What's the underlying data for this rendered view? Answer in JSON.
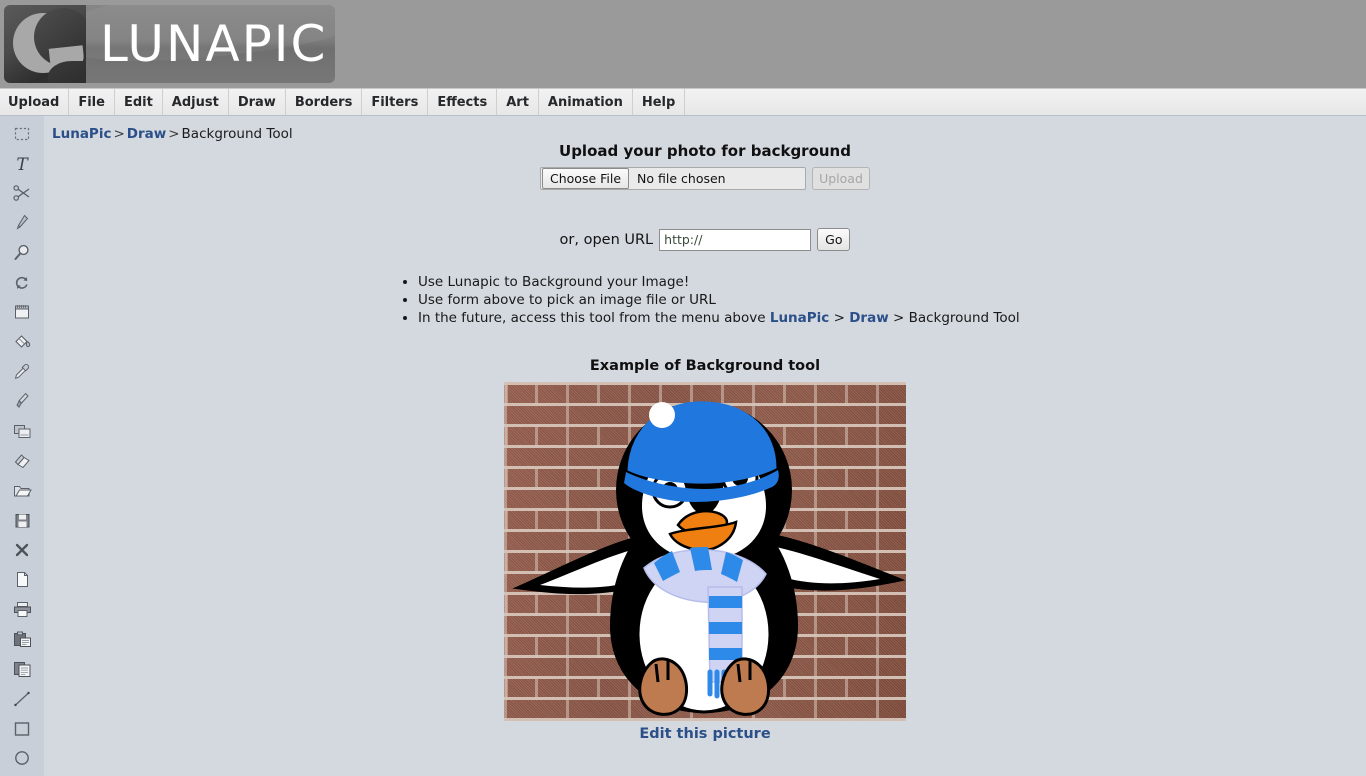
{
  "header": {
    "logo_text": "LUNAPIC",
    "logo_icon": "crescent-moon-icon"
  },
  "menubar": {
    "items": [
      {
        "label": "Upload"
      },
      {
        "label": "File"
      },
      {
        "label": "Edit"
      },
      {
        "label": "Adjust"
      },
      {
        "label": "Draw"
      },
      {
        "label": "Borders"
      },
      {
        "label": "Filters"
      },
      {
        "label": "Effects"
      },
      {
        "label": "Art"
      },
      {
        "label": "Animation"
      },
      {
        "label": "Help"
      }
    ]
  },
  "breadcrumb": {
    "root": "LunaPic",
    "sep1": ">",
    "section": "Draw",
    "sep2": ">",
    "current": "Background Tool"
  },
  "toolbar": {
    "tools": [
      {
        "name": "marquee-select-icon",
        "title": "Select"
      },
      {
        "name": "text-icon",
        "title": "Text"
      },
      {
        "name": "scissors-icon",
        "title": "Crop / Cut"
      },
      {
        "name": "pencil-icon",
        "title": "Pencil"
      },
      {
        "name": "magnifier-icon",
        "title": "Zoom"
      },
      {
        "name": "rotate-icon",
        "title": "Rotate"
      },
      {
        "name": "notepad-icon",
        "title": "Notes"
      },
      {
        "name": "paint-bucket-icon",
        "title": "Fill"
      },
      {
        "name": "eyedropper-icon",
        "title": "Color Picker"
      },
      {
        "name": "paintbrush-icon",
        "title": "Brush"
      },
      {
        "name": "layers-icon",
        "title": "Layers"
      },
      {
        "name": "eraser-icon",
        "title": "Eraser"
      },
      {
        "name": "open-folder-icon",
        "title": "Open"
      },
      {
        "name": "save-floppy-icon",
        "title": "Save"
      },
      {
        "name": "close-x-icon",
        "title": "Close"
      },
      {
        "name": "new-page-icon",
        "title": "New"
      },
      {
        "name": "printer-icon",
        "title": "Print"
      },
      {
        "name": "paste-icon",
        "title": "Paste"
      },
      {
        "name": "copy-icon",
        "title": "Copy"
      },
      {
        "name": "line-icon",
        "title": "Line"
      },
      {
        "name": "rectangle-icon",
        "title": "Rectangle"
      },
      {
        "name": "ellipse-icon",
        "title": "Ellipse"
      }
    ]
  },
  "upload": {
    "title": "Upload your photo for background",
    "choose_file_label": "Choose File",
    "file_name_text": "No file chosen",
    "upload_button_label": "Upload",
    "url_label": "or, open URL",
    "url_value": "http://",
    "url_placeholder": "http://",
    "go_button_label": "Go"
  },
  "instructions": {
    "bullets": [
      {
        "text": "Use Lunapic to Background your Image!"
      },
      {
        "text": "Use form above to pick an image file or URL"
      }
    ],
    "last_bullet": {
      "prefix": "In the future, access this tool from the menu above ",
      "link1": "LunaPic",
      "sep1": " > ",
      "link2": "Draw",
      "sep2": " > ",
      "suffix": "Background Tool"
    }
  },
  "example": {
    "title": "Example of Background tool",
    "image_alt": "penguin-with-blue-hat-and-scarf-on-brick-wall",
    "edit_link_label": "Edit this picture"
  },
  "colors": {
    "page_background": "#d4d9e0",
    "header_background": "#9a9a9a",
    "toolbar_background": "#c9cfd8",
    "link": "#2b4f88",
    "menu_background": "#ececec",
    "brick_red": "#94604f",
    "hat_blue": "#2077dd",
    "beak_orange": "#ef7f10",
    "foot_brown": "#bd7b4f",
    "scarf_light": "#cfd4f5",
    "scarf_blue": "#2d8ae8"
  }
}
